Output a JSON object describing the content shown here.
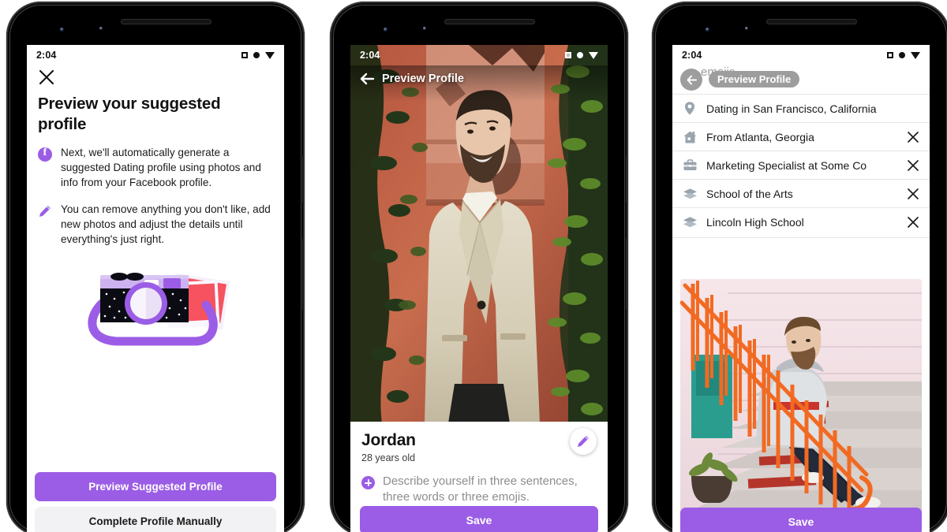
{
  "meta": {
    "accent_purple": "#9b5de5",
    "status_time": "2:04",
    "status_icons": [
      "square-icon",
      "circle-icon",
      "triangle-down-icon"
    ]
  },
  "phone1": {
    "status_time": "2:04",
    "close_icon": "close-icon",
    "title": "Preview your suggested profile",
    "bullets": [
      {
        "icon": "facebook-icon",
        "text": "Next, we'll automatically generate a suggested Dating profile using photos and info from your Facebook profile."
      },
      {
        "icon": "pencil-icon",
        "text": "You can remove anything you don't like, add new photos and adjust the details until everything's just right."
      }
    ],
    "illustration": "camera-photos-illustration",
    "primary_button": "Preview Suggested Profile",
    "secondary_button": "Complete Profile Manually"
  },
  "phone2": {
    "status_time": "2:04",
    "back_icon": "back-arrow-icon",
    "header_title": "Preview Profile",
    "photo_alt": "man-in-cream-suit-in-front-of-ivy-wall",
    "name": "Jordan",
    "age": "28 years old",
    "edit_icon": "pencil-edit-icon",
    "prompt_icon": "plus-circle-icon",
    "prompt_text": "Describe yourself in three sentences, three words or three emojis.",
    "save_button": "Save"
  },
  "phone3": {
    "status_time": "2:04",
    "scrolled_text": "emojis.",
    "back_icon": "back-arrow-icon",
    "header_title": "Preview Profile",
    "info_rows": [
      {
        "icon": "location-pin-icon",
        "text": "Dating in San Francisco, California",
        "removable": false
      },
      {
        "icon": "home-icon",
        "text": "From Atlanta, Georgia",
        "removable": true
      },
      {
        "icon": "briefcase-icon",
        "text": "Marketing Specialist at Some Co",
        "removable": true
      },
      {
        "icon": "graduation-cap-icon",
        "text": "School of the Arts",
        "removable": true
      },
      {
        "icon": "graduation-cap-icon",
        "text": "Lincoln High School",
        "removable": true
      }
    ],
    "remove_icon": "close-x-icon",
    "photo_alt": "man-sitting-on-orange-staircase-against-pink-wall",
    "save_button": "Save"
  }
}
